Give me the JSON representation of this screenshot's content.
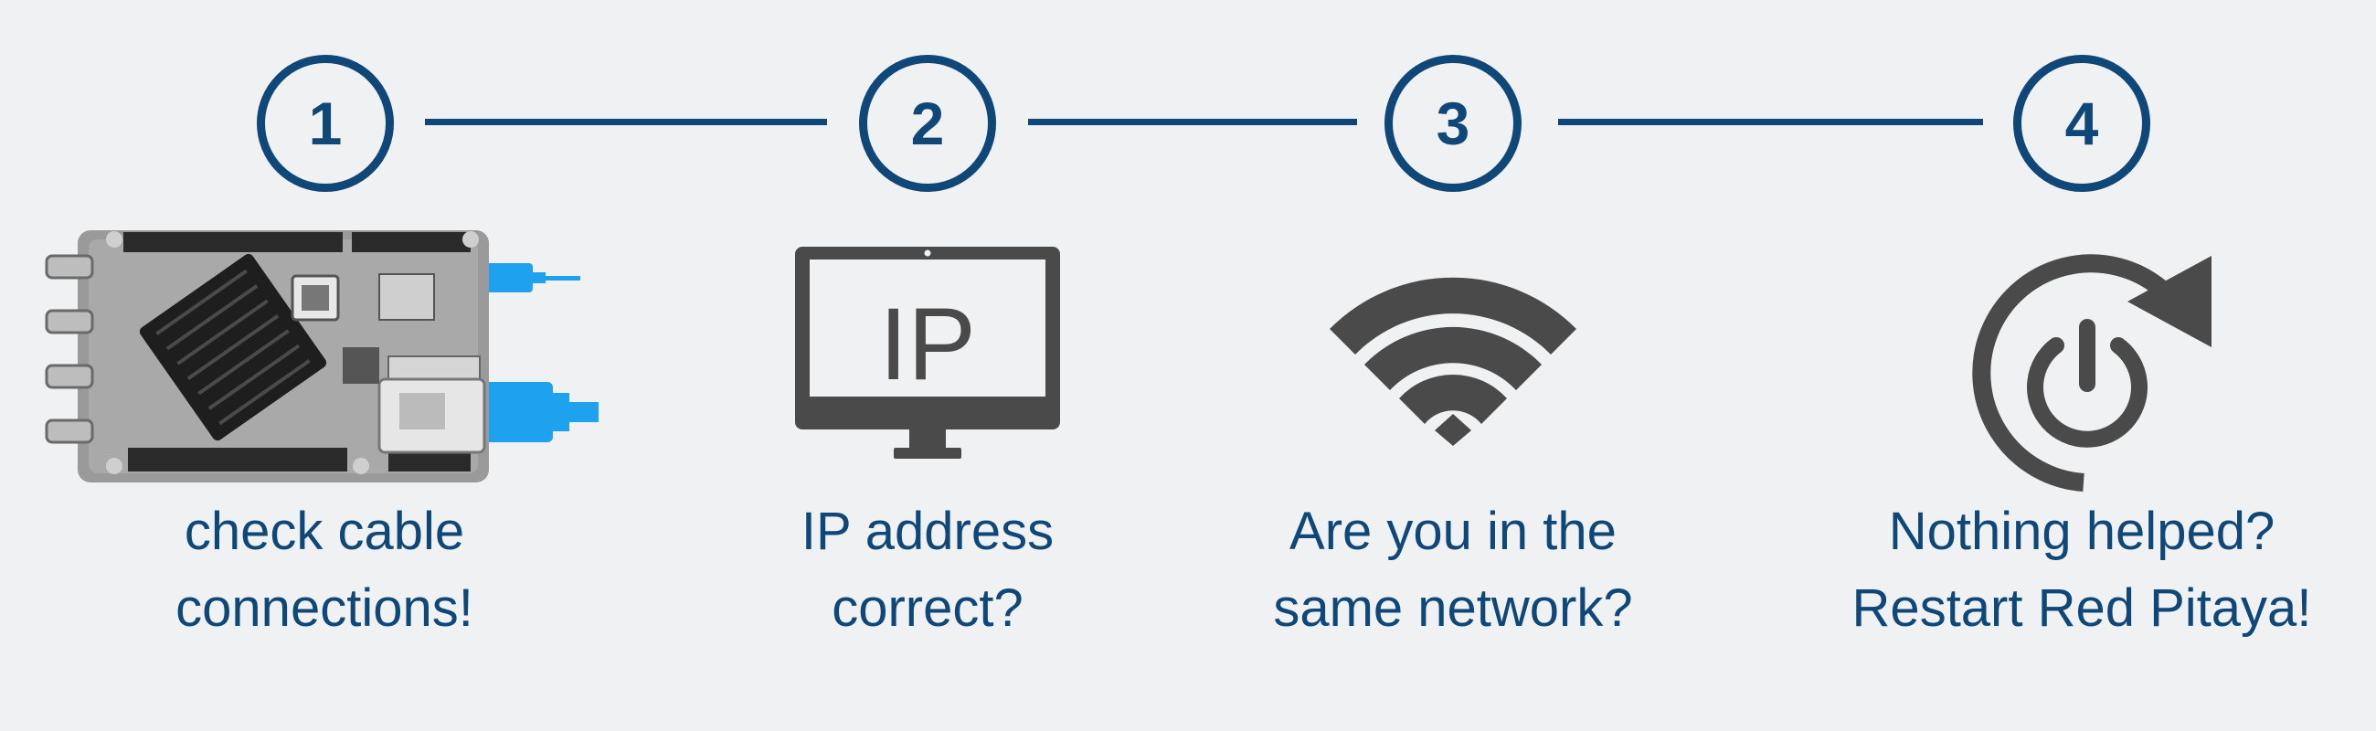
{
  "colors": {
    "primary": "#0f4779",
    "icon_gray": "#4a4a4a",
    "cable_blue": "#1ea1ef",
    "background": "#eff1f3"
  },
  "steps": [
    {
      "number": "1",
      "icon": "board-with-cables-image",
      "label_lines": [
        "check cable",
        "connections!"
      ]
    },
    {
      "number": "2",
      "icon": "monitor-ip-icon",
      "icon_text": "IP",
      "label_lines": [
        "IP address",
        "correct?"
      ]
    },
    {
      "number": "3",
      "icon": "wifi-icon",
      "label_lines": [
        "Are you in the",
        "same network?"
      ]
    },
    {
      "number": "4",
      "icon": "restart-power-icon",
      "label_lines": [
        "Nothing helped?",
        "Restart Red Pitaya!"
      ]
    }
  ]
}
